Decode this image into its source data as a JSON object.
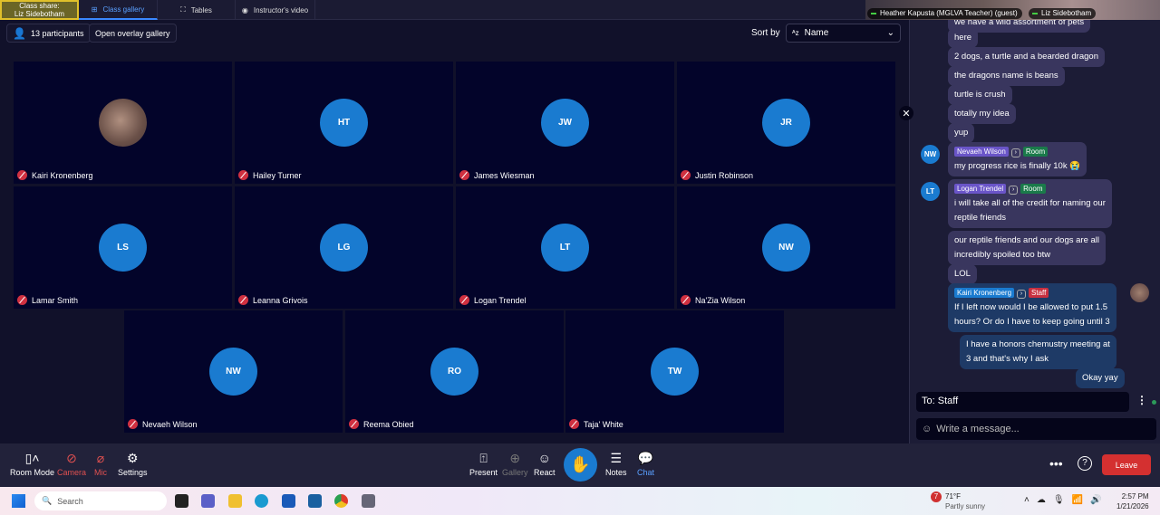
{
  "tabs": {
    "share_line1": "Class share:",
    "share_line2": "Liz Sidebotham",
    "gallery": "Class gallery",
    "tables": "Tables",
    "instructor": "Instructor's video"
  },
  "video_strip": [
    "Heather Kapusta (MGLVA Teacher) (guest)",
    "Liz Sidebotham"
  ],
  "toolbar": {
    "participants": "13 participants",
    "overlay": "Open overlay gallery",
    "sort_label": "Sort by",
    "sort_value": "Name"
  },
  "tiles": [
    {
      "initials": "",
      "name": "Kairi Kronenberg",
      "photo": true
    },
    {
      "initials": "HT",
      "name": "Hailey Turner"
    },
    {
      "initials": "JW",
      "name": "James Wiesman"
    },
    {
      "initials": "JR",
      "name": "Justin Robinson"
    },
    {
      "initials": "LS",
      "name": "Lamar Smith"
    },
    {
      "initials": "LG",
      "name": "Leanna Grivois"
    },
    {
      "initials": "LT",
      "name": "Logan Trendel"
    },
    {
      "initials": "NW",
      "name": "Na'Zia Wilson"
    },
    {
      "initials": "NW",
      "name": "Nevaeh Wilson"
    },
    {
      "initials": "RO",
      "name": "Reema Obied"
    },
    {
      "initials": "TW",
      "name": "Taja' White"
    }
  ],
  "chat": {
    "messages": [
      {
        "text": "we have a wild assortment of pets"
      },
      {
        "text": "here"
      },
      {
        "text": "2 dogs, a turtle and a bearded dragon"
      },
      {
        "text": "the dragons name is beans"
      },
      {
        "text": "turtle is crush"
      },
      {
        "text": "totally my idea"
      },
      {
        "text": "yup"
      },
      {
        "avatar": "NW",
        "sender": "Nevaeh Wilson",
        "scope": "Room",
        "text": "my progress rice is finally 10k 😭"
      },
      {
        "avatar": "LT",
        "sender": "Logan Trendel",
        "scope": "Room",
        "text": "i will take all of the credit for naming our",
        "text2": "reptile friends"
      },
      {
        "text": "our reptile friends and our dogs are all",
        "text2": "incredibly spoiled too btw"
      },
      {
        "text": "LOL"
      },
      {
        "sender": "Kairi Kronenberg",
        "scope": "Staff",
        "text": "If I left now would I be allowed to put 1.5",
        "text2": "hours? Or do I have to keep going until 3"
      },
      {
        "text": "I have a honors chemustry meeting at",
        "text2": "3 and that's why I ask"
      },
      {
        "text": "Okay yay"
      }
    ],
    "to": "To: Staff",
    "placeholder": "Write a message..."
  },
  "bottom": {
    "room_mode": "Room Mode",
    "camera": "Camera",
    "mic": "Mic",
    "settings": "Settings",
    "present": "Present",
    "gallery": "Gallery",
    "react": "React",
    "notes": "Notes",
    "chat": "Chat",
    "leave": "Leave"
  },
  "taskbar": {
    "search": "Search",
    "temp": "71°F",
    "weather": "Partly sunny",
    "weather_badge": "7",
    "time": "2:57 PM",
    "date": "1/21/2026"
  }
}
